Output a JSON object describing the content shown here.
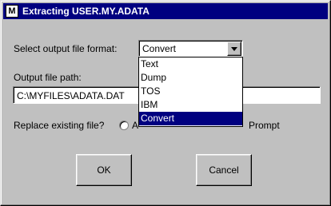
{
  "window": {
    "title": "Extracting USER.MY.ADATA"
  },
  "format": {
    "label": "Select output file format:",
    "selected": "Convert",
    "options": [
      "Text",
      "Dump",
      "TOS",
      "IBM",
      "Convert"
    ],
    "selected_index": 4
  },
  "path": {
    "label": "Output file path:",
    "value": "C:\\MYFILES\\ADATA.DAT"
  },
  "replace": {
    "label": "Replace existing file?",
    "option_visible_start": "A",
    "option_prompt": "Prompt"
  },
  "buttons": {
    "ok": "OK",
    "cancel": "Cancel"
  },
  "colors": {
    "titlebar": "#000080",
    "face": "#c0c0c0",
    "selection": "#000080"
  },
  "icons": {
    "app": "mainframe-app-icon",
    "dropdown": "chevron-down-icon"
  }
}
